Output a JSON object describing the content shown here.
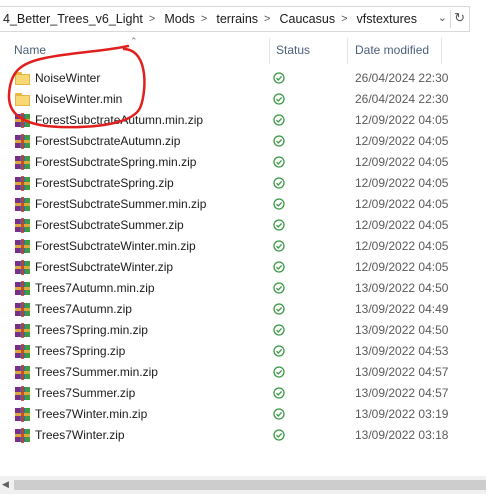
{
  "breadcrumb": {
    "items": [
      "4_Better_Trees_v6_Light",
      "Mods",
      "terrains",
      "Caucasus",
      "vfstextures"
    ],
    "separator": ">"
  },
  "columns": {
    "name": "Name",
    "status": "Status",
    "date_modified": "Date modified"
  },
  "files": [
    {
      "name": "NoiseWinter",
      "type": "folder",
      "date": "26/04/2024 22:30"
    },
    {
      "name": "NoiseWinter.min",
      "type": "folder",
      "date": "26/04/2024 22:30"
    },
    {
      "name": "ForestSubctrateAutumn.min.zip",
      "type": "zip",
      "date": "12/09/2022 04:05"
    },
    {
      "name": "ForestSubctrateAutumn.zip",
      "type": "zip",
      "date": "12/09/2022 04:05"
    },
    {
      "name": "ForestSubctrateSpring.min.zip",
      "type": "zip",
      "date": "12/09/2022 04:05"
    },
    {
      "name": "ForestSubctrateSpring.zip",
      "type": "zip",
      "date": "12/09/2022 04:05"
    },
    {
      "name": "ForestSubctrateSummer.min.zip",
      "type": "zip",
      "date": "12/09/2022 04:05"
    },
    {
      "name": "ForestSubctrateSummer.zip",
      "type": "zip",
      "date": "12/09/2022 04:05"
    },
    {
      "name": "ForestSubctrateWinter.min.zip",
      "type": "zip",
      "date": "12/09/2022 04:05"
    },
    {
      "name": "ForestSubctrateWinter.zip",
      "type": "zip",
      "date": "12/09/2022 04:05"
    },
    {
      "name": "Trees7Autumn.min.zip",
      "type": "zip",
      "date": "13/09/2022 04:50"
    },
    {
      "name": "Trees7Autumn.zip",
      "type": "zip",
      "date": "13/09/2022 04:49"
    },
    {
      "name": "Trees7Spring.min.zip",
      "type": "zip",
      "date": "13/09/2022 04:50"
    },
    {
      "name": "Trees7Spring.zip",
      "type": "zip",
      "date": "13/09/2022 04:53"
    },
    {
      "name": "Trees7Summer.min.zip",
      "type": "zip",
      "date": "13/09/2022 04:57"
    },
    {
      "name": "Trees7Summer.zip",
      "type": "zip",
      "date": "13/09/2022 04:57"
    },
    {
      "name": "Trees7Winter.min.zip",
      "type": "zip",
      "date": "13/09/2022 03:19"
    },
    {
      "name": "Trees7Winter.zip",
      "type": "zip",
      "date": "13/09/2022 03:18"
    }
  ],
  "status_icon": "synced-check-icon",
  "colors": {
    "status_green": "#3b9a45",
    "annotation_red": "#e0201e",
    "header_text": "#4c607a"
  }
}
